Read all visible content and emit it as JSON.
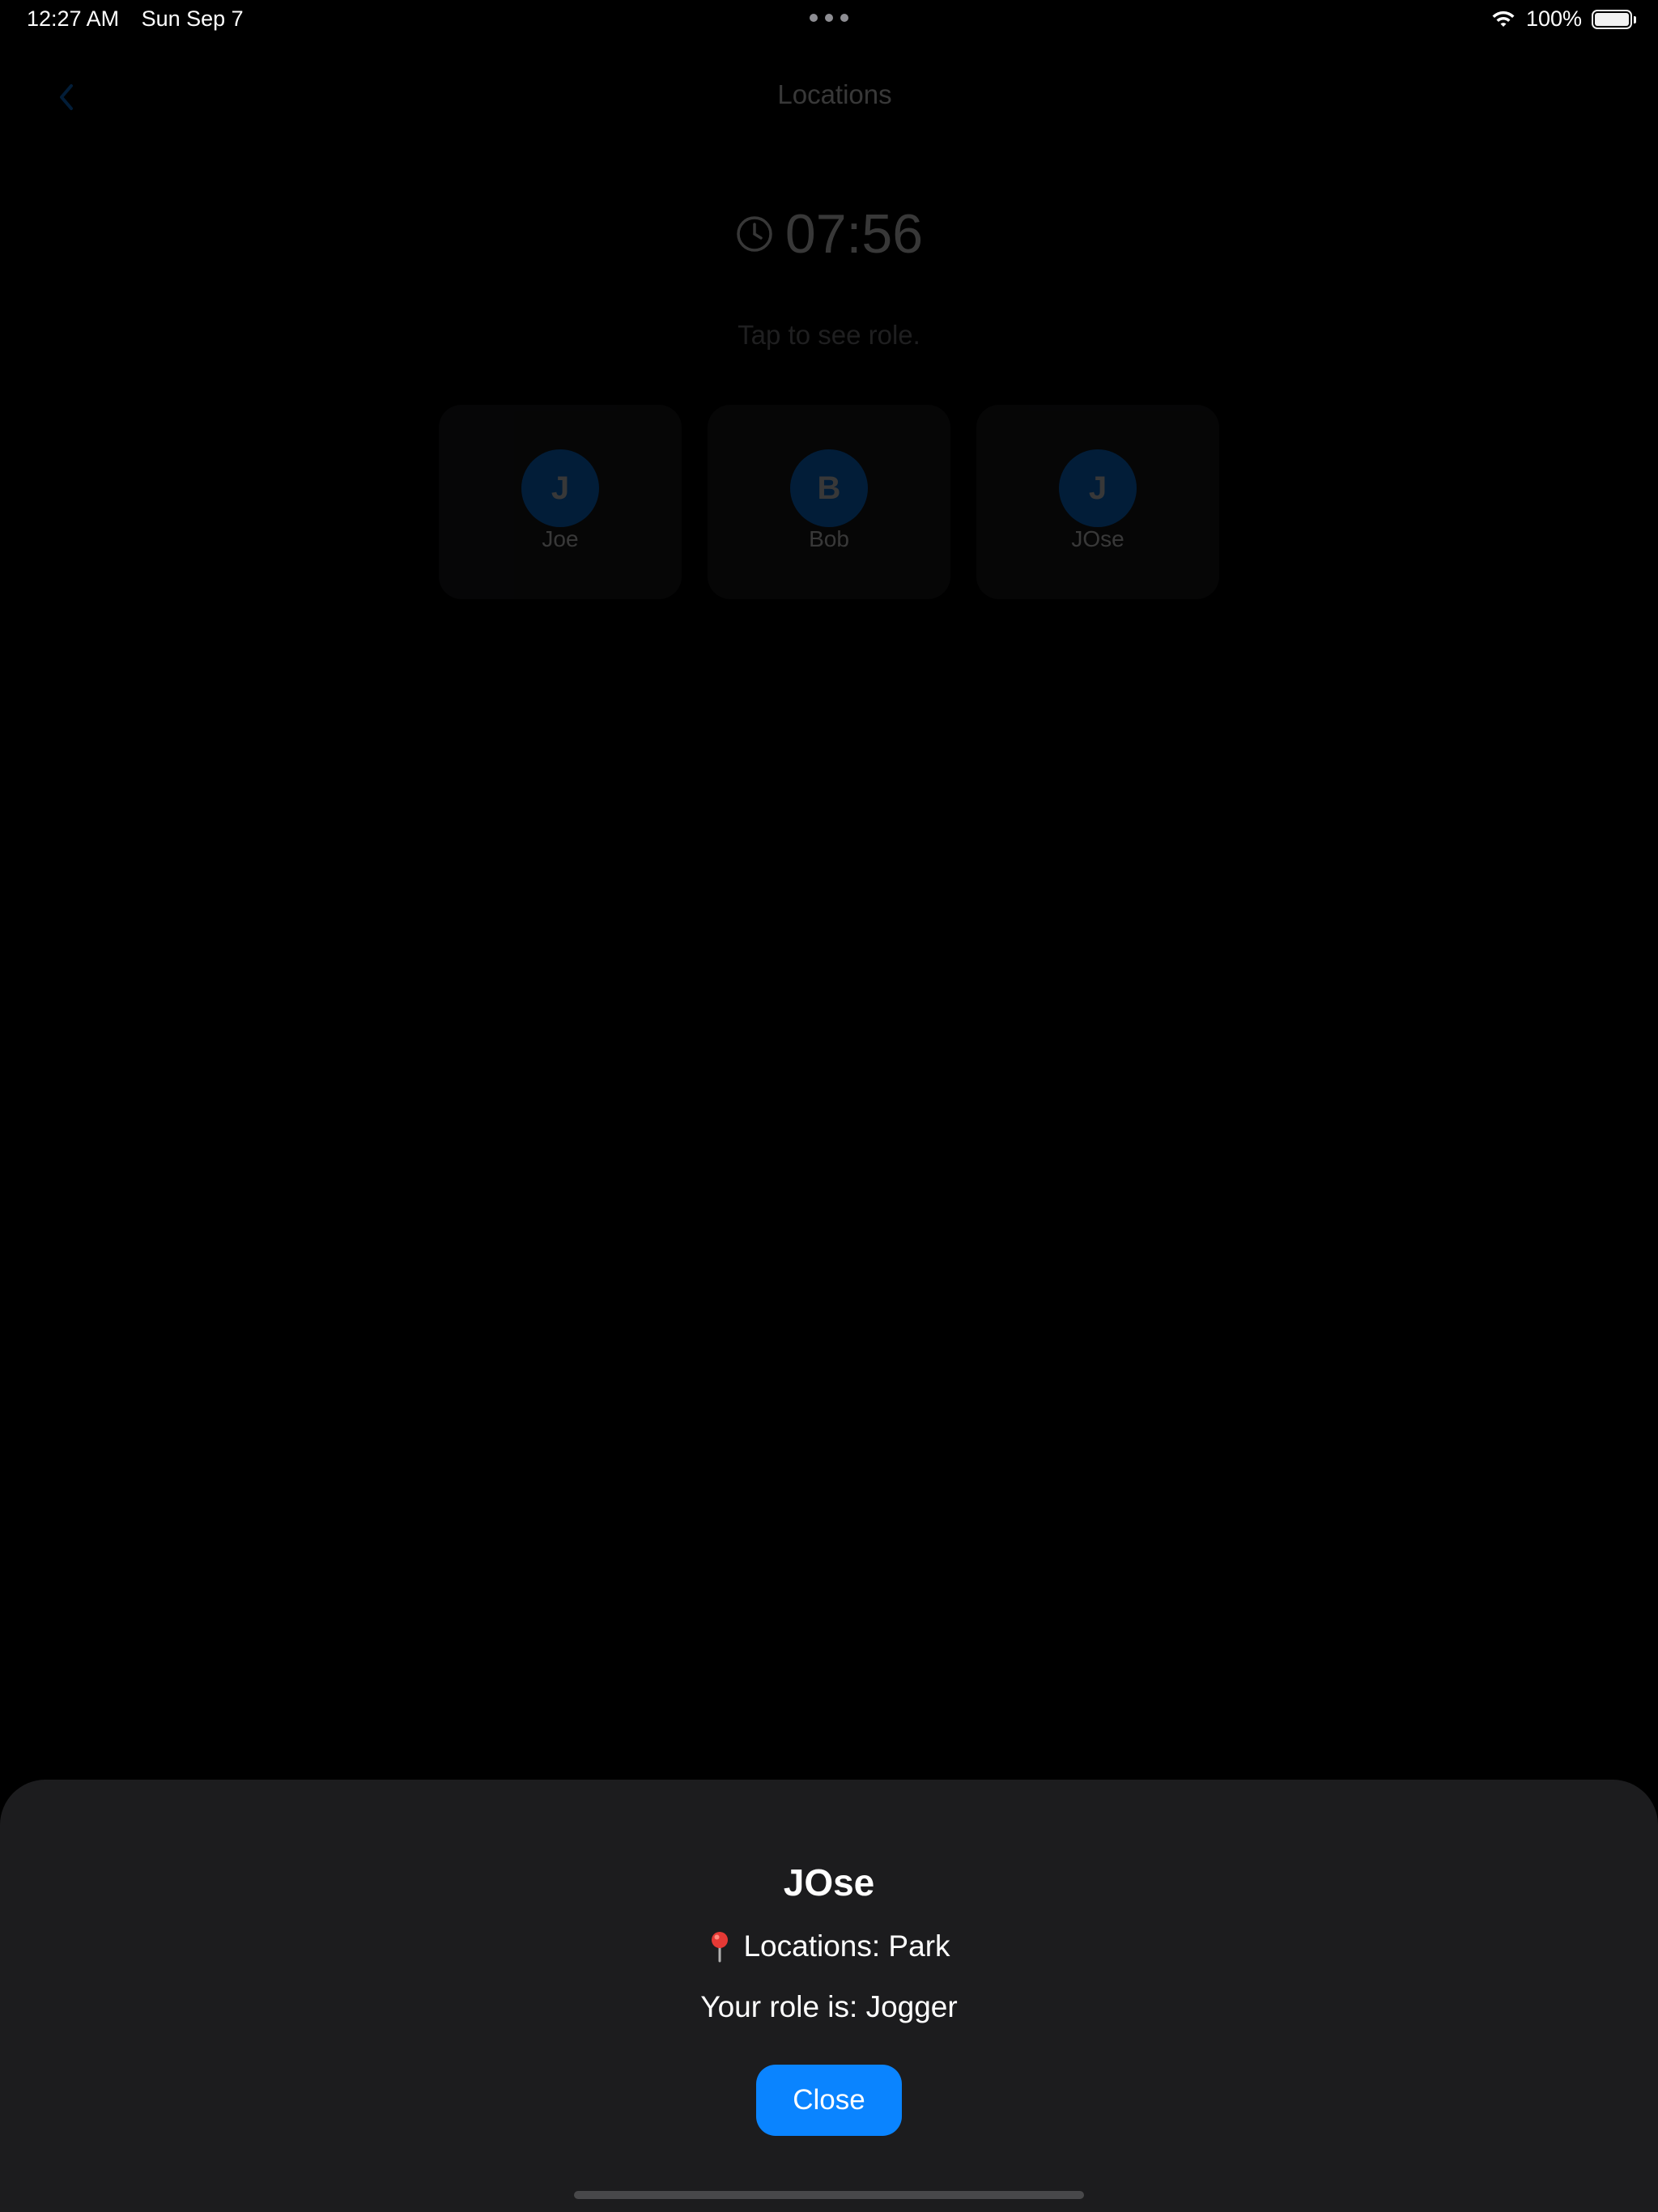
{
  "status_bar": {
    "time": "12:27 AM",
    "date": "Sun Sep 7",
    "battery": "100%",
    "battery_level": 1.0
  },
  "nav": {
    "title": "Locations",
    "back_icon": "chevron-left-icon"
  },
  "timer": {
    "value": "07:56",
    "icon": "clock-icon"
  },
  "hint": "Tap to see role.",
  "players": [
    {
      "initial": "J",
      "name": "Joe"
    },
    {
      "initial": "B",
      "name": "Bob"
    },
    {
      "initial": "J",
      "name": "JOse"
    }
  ],
  "sheet": {
    "title": "JOse",
    "location_icon": "pin-icon",
    "location_text": "Locations: Park",
    "role_text": "Your role is: Jogger",
    "close_label": "Close"
  },
  "colors": {
    "accent": "#0a84ff",
    "sheet_background": "#1c1c1e",
    "background": "#000000"
  }
}
